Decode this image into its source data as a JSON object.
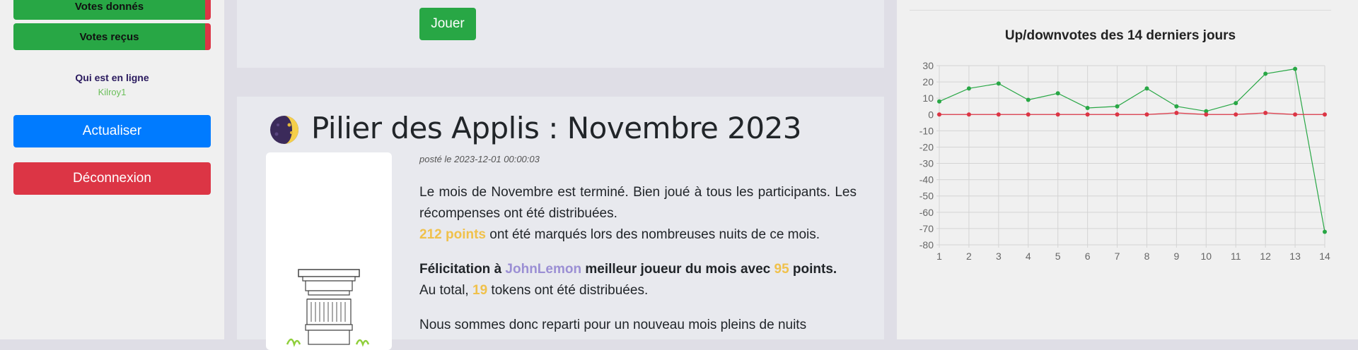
{
  "sidebar": {
    "votes_given": "Votes donnés",
    "votes_received": "Votes reçus",
    "online_title": "Qui est en ligne",
    "online_user": "Kilroy1",
    "refresh": "Actualiser",
    "logout": "Déconnexion"
  },
  "top_card": {
    "play": "Jouer"
  },
  "post": {
    "title": "Pilier des Applis : Novembre 2023",
    "date": "posté le 2023-12-01 00:00:03",
    "p1_line1": "Le mois de Novembre est terminé. Bien joué à tous les participants. Les récompenses ont été distribuées.",
    "p1_points": "212 points",
    "p1_rest": " ont été marqués lors des nombreuses nuits de ce mois.",
    "p2_a": "Félicitation à ",
    "p2_user": "JohnLemon",
    "p2_b": " meilleur joueur du mois avec ",
    "p2_score": "95",
    "p2_c": " points.",
    "p2_d": "Au total, ",
    "p2_tokens": "19",
    "p2_e": " tokens ont été distribuées.",
    "p3": "Nous sommes donc reparti pour un nouveau mois pleins de nuits"
  },
  "colors": {
    "green": "#28a745",
    "red": "#dc3545",
    "blue": "#007bff",
    "gold": "#f0c14b",
    "purple": "#9b8fd4"
  },
  "icons": {
    "post_icon": "moon-icon",
    "post_image": "pillar-image"
  },
  "chart_data": {
    "type": "line",
    "title": "Up/downvotes des 14 derniers jours",
    "x": [
      1,
      2,
      3,
      4,
      5,
      6,
      7,
      8,
      9,
      10,
      11,
      12,
      13,
      14
    ],
    "ylim": [
      -80,
      30
    ],
    "yticks": [
      30,
      20,
      10,
      0,
      -10,
      -20,
      -30,
      -40,
      -50,
      -60,
      -70,
      -80
    ],
    "grid": true,
    "series": [
      {
        "color": "#28a745",
        "values": [
          8,
          16,
          19,
          9,
          13,
          4,
          5,
          16,
          5,
          2,
          7,
          25,
          28,
          -72
        ]
      },
      {
        "color": "#dc3545",
        "values": [
          0,
          0,
          0,
          0,
          0,
          0,
          0,
          0,
          1,
          0,
          0,
          1,
          0,
          0
        ]
      }
    ]
  }
}
